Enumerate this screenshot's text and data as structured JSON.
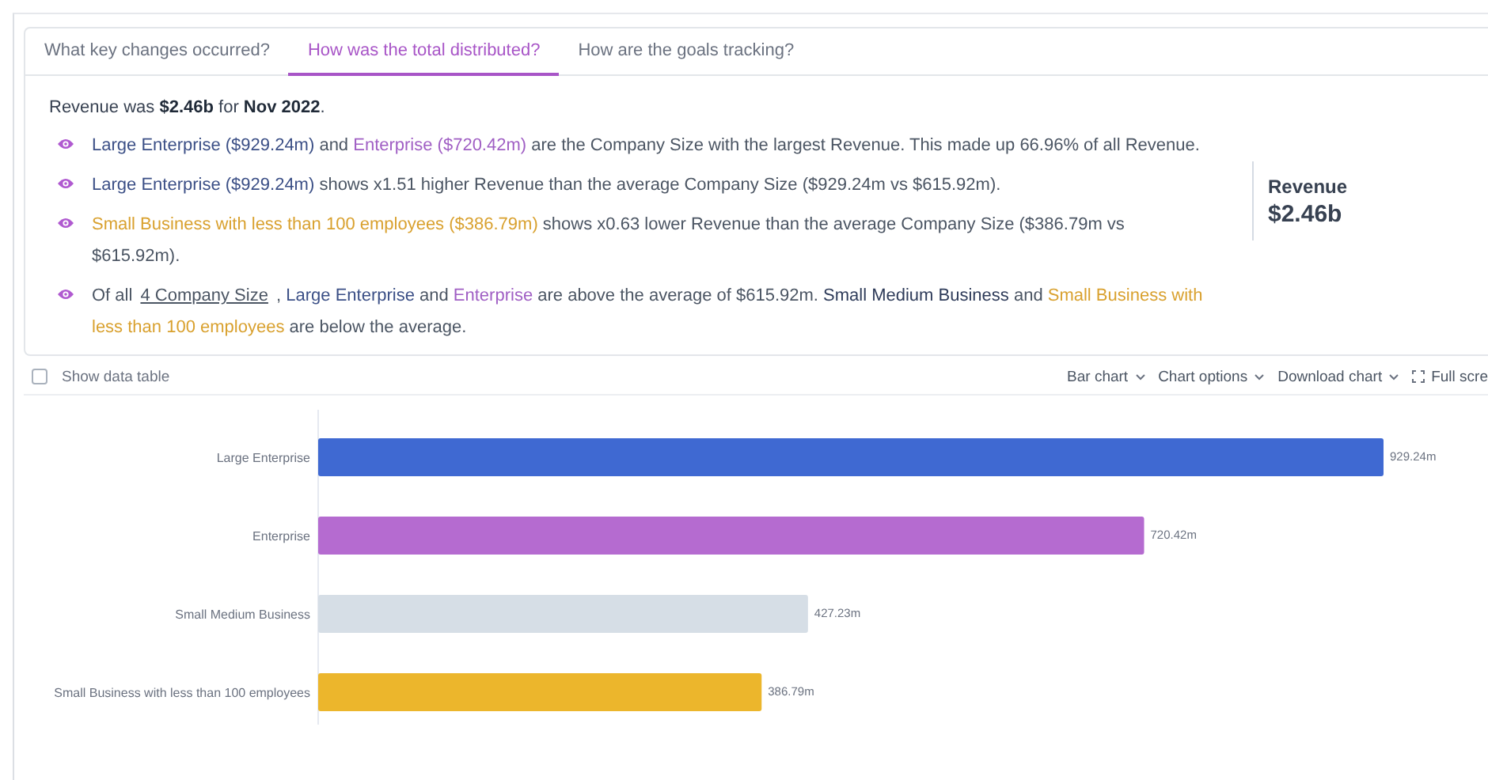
{
  "tabs": [
    {
      "label": "What key changes occurred?",
      "selected": false
    },
    {
      "label": "How was the total distributed?",
      "selected": true
    },
    {
      "label": "How are the goals tracking?",
      "selected": false
    }
  ],
  "summary": {
    "headline": "Revenue was **$2.46b** for **Nov 2022**.",
    "insights": [
      {
        "segments": [
          {
            "kind": "blue",
            "text": "Large Enterprise ($929.24m)"
          },
          {
            "kind": "plain",
            "text": " and "
          },
          {
            "kind": "purple",
            "text": "Enterprise ($720.42m)"
          },
          {
            "kind": "plain",
            "text": " are the Company Size with the largest Revenue. This made up 66.96% of all Revenue."
          }
        ]
      },
      {
        "segments": [
          {
            "kind": "blue",
            "text": "Large Enterprise ($929.24m)"
          },
          {
            "kind": "plain",
            "text": " shows x1.51 higher Revenue than the average Company Size ($929.24m vs $615.92m)."
          }
        ]
      },
      {
        "segments": [
          {
            "kind": "gold",
            "text": "Small Business with less than 100 employees ($386.79m)"
          },
          {
            "kind": "plain",
            "text": " shows x0.63 lower Revenue than the average Company Size ($386.79m vs $615.92m)."
          }
        ]
      },
      {
        "segments": [
          {
            "kind": "plain",
            "text": "Of all "
          },
          {
            "kind": "link",
            "text": "4 Company Size"
          },
          {
            "kind": "plain",
            "text": " , "
          },
          {
            "kind": "blue",
            "text": "Large Enterprise"
          },
          {
            "kind": "plain",
            "text": " and "
          },
          {
            "kind": "purple",
            "text": "Enterprise"
          },
          {
            "kind": "plain",
            "text": " are above the average of $615.92m. "
          },
          {
            "kind": "dark",
            "text": "Small Medium Business"
          },
          {
            "kind": "plain",
            "text": " and "
          },
          {
            "kind": "gold",
            "text": "Small Business with less than 100 employees"
          },
          {
            "kind": "plain",
            "text": " are below the average."
          }
        ]
      }
    ],
    "kpi": {
      "label": "Revenue",
      "value": "$2.46b"
    }
  },
  "toolbar": {
    "show_data_table": {
      "label": "Show data table",
      "checked": false
    },
    "menus": [
      {
        "label": "Bar chart"
      },
      {
        "label": "Chart options"
      },
      {
        "label": "Download chart"
      }
    ],
    "fullscreen": {
      "label": "Full scre"
    }
  },
  "chart": {
    "chart_data": {
      "type": "bar",
      "orientation": "horizontal",
      "categories": [
        "Large Enterprise",
        "Enterprise",
        "Small Medium Business",
        "Small Business with less than 100 employees"
      ],
      "values": [
        929.24,
        720.42,
        427.23,
        386.79
      ],
      "colors": [
        "#3f69d2",
        "#b56bd0",
        "#d6dee6",
        "#ecb62c"
      ],
      "value_labels": [
        "929.24m",
        "720.42m",
        "427.23m",
        "386.79m"
      ]
    }
  }
}
